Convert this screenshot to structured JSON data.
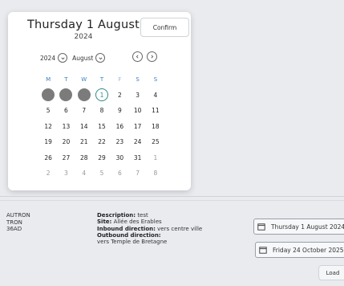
{
  "calendar": {
    "title_day": "Thursday 1 August",
    "title_year": "2024",
    "confirm_label": "Confirm",
    "year_select": "2024",
    "month_select": "August",
    "weekday_headers": [
      "M",
      "T",
      "W",
      "T",
      "F",
      "S",
      "S"
    ],
    "weeks": [
      [
        {
          "d": "",
          "state": "disabled"
        },
        {
          "d": "",
          "state": "disabled"
        },
        {
          "d": "",
          "state": "disabled"
        },
        {
          "d": "1",
          "state": "selected"
        },
        {
          "d": "2",
          "state": "normal"
        },
        {
          "d": "3",
          "state": "normal"
        },
        {
          "d": "4",
          "state": "normal"
        }
      ],
      [
        {
          "d": "5",
          "state": "normal"
        },
        {
          "d": "6",
          "state": "normal"
        },
        {
          "d": "7",
          "state": "normal"
        },
        {
          "d": "8",
          "state": "normal"
        },
        {
          "d": "9",
          "state": "normal"
        },
        {
          "d": "10",
          "state": "normal"
        },
        {
          "d": "11",
          "state": "normal"
        }
      ],
      [
        {
          "d": "12",
          "state": "normal"
        },
        {
          "d": "13",
          "state": "normal"
        },
        {
          "d": "14",
          "state": "normal"
        },
        {
          "d": "15",
          "state": "normal"
        },
        {
          "d": "16",
          "state": "normal"
        },
        {
          "d": "17",
          "state": "normal"
        },
        {
          "d": "18",
          "state": "normal"
        }
      ],
      [
        {
          "d": "19",
          "state": "normal"
        },
        {
          "d": "20",
          "state": "normal"
        },
        {
          "d": "21",
          "state": "normal"
        },
        {
          "d": "22",
          "state": "normal"
        },
        {
          "d": "23",
          "state": "normal"
        },
        {
          "d": "24",
          "state": "normal"
        },
        {
          "d": "25",
          "state": "normal"
        }
      ],
      [
        {
          "d": "26",
          "state": "normal"
        },
        {
          "d": "27",
          "state": "normal"
        },
        {
          "d": "28",
          "state": "normal"
        },
        {
          "d": "29",
          "state": "normal"
        },
        {
          "d": "30",
          "state": "normal"
        },
        {
          "d": "31",
          "state": "normal"
        },
        {
          "d": "1",
          "state": "muted"
        }
      ],
      [
        {
          "d": "2",
          "state": "muted"
        },
        {
          "d": "3",
          "state": "muted"
        },
        {
          "d": "4",
          "state": "muted"
        },
        {
          "d": "5",
          "state": "muted"
        },
        {
          "d": "6",
          "state": "muted"
        },
        {
          "d": "7",
          "state": "muted"
        },
        {
          "d": "8",
          "state": "muted"
        }
      ]
    ]
  },
  "left_col": [
    "AUTRON",
    "TRON",
    "36AD"
  ],
  "info": {
    "description_label": "Description:",
    "description_value": "test",
    "site_label": "Site:",
    "site_value": "Allée des Erables",
    "inbound_label": "Inbound direction:",
    "inbound_value": "vers centre ville",
    "outbound_label": "Outbound direction:",
    "outbound_value": "vers Temple de Bretagne"
  },
  "date_start_label": "Thursday 1 August 2024",
  "date_end_label": "Friday 24 October 2025",
  "load_label": "Load",
  "colors": {
    "selected_accent": "#2c8c86",
    "weekday_header": "#3a7ec0",
    "disabled_day": "#7b7b7b"
  }
}
